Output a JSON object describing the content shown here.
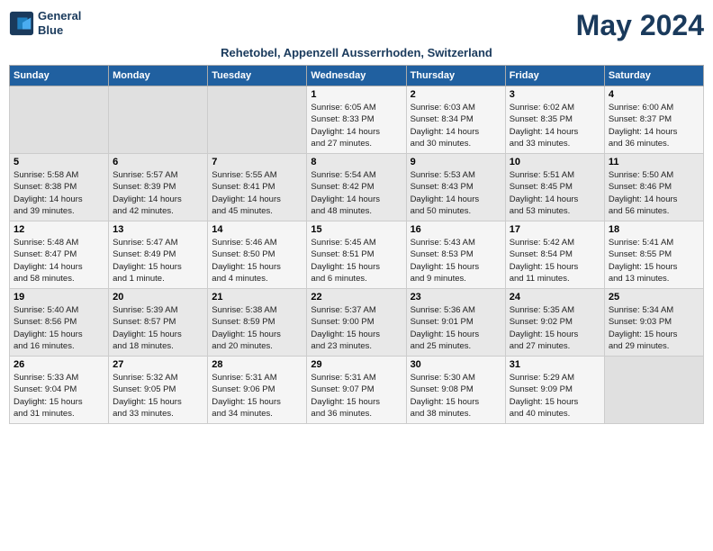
{
  "header": {
    "logo_line1": "General",
    "logo_line2": "Blue",
    "month_title": "May 2024",
    "subtitle": "Rehetobel, Appenzell Ausserrhoden, Switzerland"
  },
  "days_of_week": [
    "Sunday",
    "Monday",
    "Tuesday",
    "Wednesday",
    "Thursday",
    "Friday",
    "Saturday"
  ],
  "weeks": [
    [
      {
        "day": "",
        "info": ""
      },
      {
        "day": "",
        "info": ""
      },
      {
        "day": "",
        "info": ""
      },
      {
        "day": "1",
        "info": "Sunrise: 6:05 AM\nSunset: 8:33 PM\nDaylight: 14 hours\nand 27 minutes."
      },
      {
        "day": "2",
        "info": "Sunrise: 6:03 AM\nSunset: 8:34 PM\nDaylight: 14 hours\nand 30 minutes."
      },
      {
        "day": "3",
        "info": "Sunrise: 6:02 AM\nSunset: 8:35 PM\nDaylight: 14 hours\nand 33 minutes."
      },
      {
        "day": "4",
        "info": "Sunrise: 6:00 AM\nSunset: 8:37 PM\nDaylight: 14 hours\nand 36 minutes."
      }
    ],
    [
      {
        "day": "5",
        "info": "Sunrise: 5:58 AM\nSunset: 8:38 PM\nDaylight: 14 hours\nand 39 minutes."
      },
      {
        "day": "6",
        "info": "Sunrise: 5:57 AM\nSunset: 8:39 PM\nDaylight: 14 hours\nand 42 minutes."
      },
      {
        "day": "7",
        "info": "Sunrise: 5:55 AM\nSunset: 8:41 PM\nDaylight: 14 hours\nand 45 minutes."
      },
      {
        "day": "8",
        "info": "Sunrise: 5:54 AM\nSunset: 8:42 PM\nDaylight: 14 hours\nand 48 minutes."
      },
      {
        "day": "9",
        "info": "Sunrise: 5:53 AM\nSunset: 8:43 PM\nDaylight: 14 hours\nand 50 minutes."
      },
      {
        "day": "10",
        "info": "Sunrise: 5:51 AM\nSunset: 8:45 PM\nDaylight: 14 hours\nand 53 minutes."
      },
      {
        "day": "11",
        "info": "Sunrise: 5:50 AM\nSunset: 8:46 PM\nDaylight: 14 hours\nand 56 minutes."
      }
    ],
    [
      {
        "day": "12",
        "info": "Sunrise: 5:48 AM\nSunset: 8:47 PM\nDaylight: 14 hours\nand 58 minutes."
      },
      {
        "day": "13",
        "info": "Sunrise: 5:47 AM\nSunset: 8:49 PM\nDaylight: 15 hours\nand 1 minute."
      },
      {
        "day": "14",
        "info": "Sunrise: 5:46 AM\nSunset: 8:50 PM\nDaylight: 15 hours\nand 4 minutes."
      },
      {
        "day": "15",
        "info": "Sunrise: 5:45 AM\nSunset: 8:51 PM\nDaylight: 15 hours\nand 6 minutes."
      },
      {
        "day": "16",
        "info": "Sunrise: 5:43 AM\nSunset: 8:53 PM\nDaylight: 15 hours\nand 9 minutes."
      },
      {
        "day": "17",
        "info": "Sunrise: 5:42 AM\nSunset: 8:54 PM\nDaylight: 15 hours\nand 11 minutes."
      },
      {
        "day": "18",
        "info": "Sunrise: 5:41 AM\nSunset: 8:55 PM\nDaylight: 15 hours\nand 13 minutes."
      }
    ],
    [
      {
        "day": "19",
        "info": "Sunrise: 5:40 AM\nSunset: 8:56 PM\nDaylight: 15 hours\nand 16 minutes."
      },
      {
        "day": "20",
        "info": "Sunrise: 5:39 AM\nSunset: 8:57 PM\nDaylight: 15 hours\nand 18 minutes."
      },
      {
        "day": "21",
        "info": "Sunrise: 5:38 AM\nSunset: 8:59 PM\nDaylight: 15 hours\nand 20 minutes."
      },
      {
        "day": "22",
        "info": "Sunrise: 5:37 AM\nSunset: 9:00 PM\nDaylight: 15 hours\nand 23 minutes."
      },
      {
        "day": "23",
        "info": "Sunrise: 5:36 AM\nSunset: 9:01 PM\nDaylight: 15 hours\nand 25 minutes."
      },
      {
        "day": "24",
        "info": "Sunrise: 5:35 AM\nSunset: 9:02 PM\nDaylight: 15 hours\nand 27 minutes."
      },
      {
        "day": "25",
        "info": "Sunrise: 5:34 AM\nSunset: 9:03 PM\nDaylight: 15 hours\nand 29 minutes."
      }
    ],
    [
      {
        "day": "26",
        "info": "Sunrise: 5:33 AM\nSunset: 9:04 PM\nDaylight: 15 hours\nand 31 minutes."
      },
      {
        "day": "27",
        "info": "Sunrise: 5:32 AM\nSunset: 9:05 PM\nDaylight: 15 hours\nand 33 minutes."
      },
      {
        "day": "28",
        "info": "Sunrise: 5:31 AM\nSunset: 9:06 PM\nDaylight: 15 hours\nand 34 minutes."
      },
      {
        "day": "29",
        "info": "Sunrise: 5:31 AM\nSunset: 9:07 PM\nDaylight: 15 hours\nand 36 minutes."
      },
      {
        "day": "30",
        "info": "Sunrise: 5:30 AM\nSunset: 9:08 PM\nDaylight: 15 hours\nand 38 minutes."
      },
      {
        "day": "31",
        "info": "Sunrise: 5:29 AM\nSunset: 9:09 PM\nDaylight: 15 hours\nand 40 minutes."
      },
      {
        "day": "",
        "info": ""
      }
    ]
  ]
}
